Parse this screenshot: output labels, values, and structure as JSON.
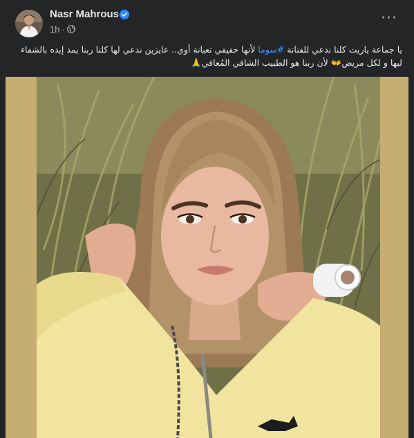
{
  "post": {
    "author": "Nasr Mahrous",
    "time": "1h",
    "separator": "·",
    "icons": {
      "verified": "verified-badge-icon",
      "audience": "globe-icon",
      "more": "more-options-icon"
    },
    "text_part1": "يا جماعة ياريت كلنا ندعي للفنانة ",
    "hashtag": "#سوما",
    "text_part2": " لأنها حقيقي تعبانة أوي.. عايزين ندعي لها كلنا ربنا يمد إيده بالشفاء ليها و لكل مريض👐 لأن ربنا هو الطبيب الشافي المُعافي🙏",
    "photo_subject": "portrait-photo"
  },
  "colors": {
    "background": "#242526",
    "text": "#e4e6eb",
    "muted": "#b0b3b8",
    "link": "#4599ff",
    "verified": "#2d88ff",
    "frame": "#c6ad71"
  }
}
